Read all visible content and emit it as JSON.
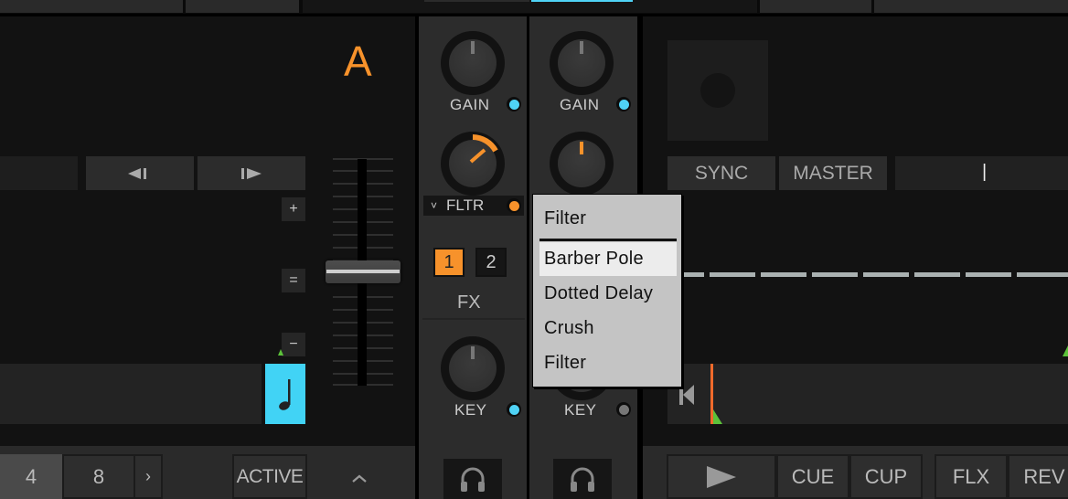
{
  "deck_a": {
    "letter": "A",
    "prev_beat_icon": "skip-back-beat-icon",
    "next_beat_icon": "skip-forward-beat-icon",
    "tempo_plus": "+",
    "tempo_reset": "=",
    "tempo_minus": "−",
    "bottom": {
      "btn_4": "4",
      "btn_8": "8",
      "next": "›",
      "active": "ACTIVE",
      "collapse": "^"
    }
  },
  "mixer": {
    "channel_1": {
      "gain_label": "GAIN",
      "fx_selector_label": "FLTR",
      "fx_selector_chevron": "˅",
      "fx_1": "1",
      "fx_2": "2",
      "fx_label": "FX",
      "key_label": "KEY"
    },
    "channel_2": {
      "gain_label": "GAIN",
      "key_label": "KEY"
    },
    "colors": {
      "accent_blue": "#4fd2f5",
      "accent_orange": "#f7922b",
      "led_off": "#777777"
    }
  },
  "fx_menu": {
    "header": "Filter",
    "items": [
      "Barber Pole",
      "Dotted Delay",
      "Crush",
      "Filter"
    ],
    "highlighted_index": 0
  },
  "deck_b": {
    "sync": "SYNC",
    "master": "MASTER",
    "tempo_cursor": "|",
    "transport": {
      "play_icon": "play-icon",
      "cue": "CUE",
      "cup": "CUP",
      "flx": "FLX",
      "rev": "REV"
    }
  }
}
